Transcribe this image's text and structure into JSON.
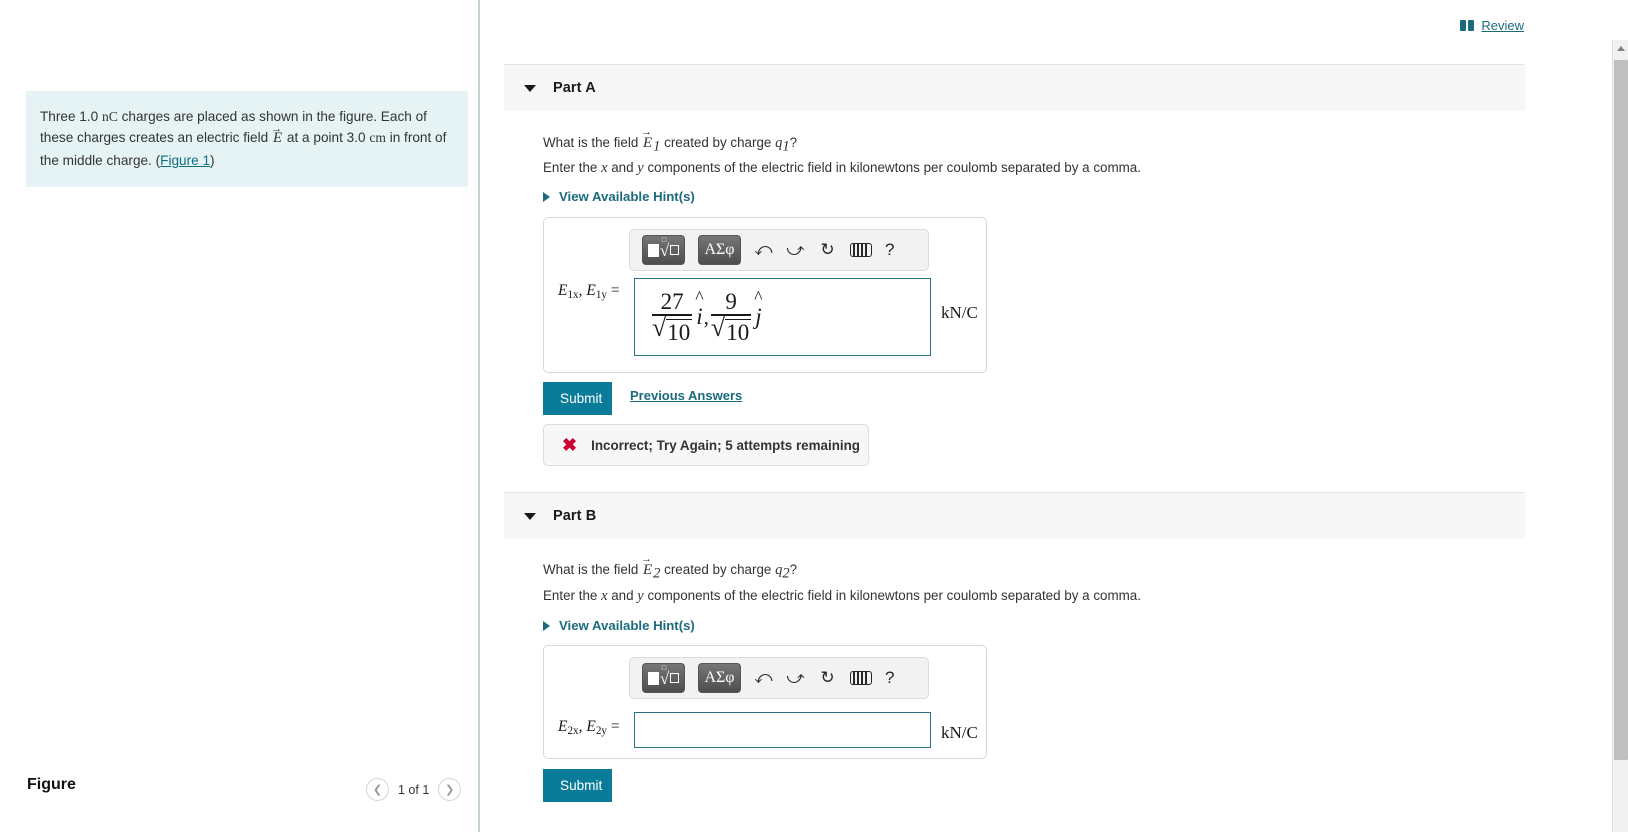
{
  "header": {
    "review_label": "Review",
    "book_icon": "book-icon"
  },
  "left_pane": {
    "problem": {
      "line1_a": "Three 1.0 ",
      "line1_unit": "nC",
      "line1_b": " charges are placed as shown in the figure. Each of these charges creates an electric field ",
      "field_symbol": "E",
      "line2_a": " at a point 3.0 ",
      "line2_unit": "cm",
      "line2_b": " in front of the middle charge. (",
      "figure_link": "Figure 1",
      "line2_c": ")"
    },
    "figure_title": "Figure",
    "figure_counter": "1 of 1",
    "prev_icon": "chevron-left-icon",
    "next_icon": "chevron-right-icon"
  },
  "math_toolbar": {
    "sqrt_button": "sqrt-template-button",
    "greek_button": "ΑΣφ",
    "undo_icon": "undo-icon",
    "redo_icon": "redo-icon",
    "reset_icon": "reset-icon",
    "keyboard_icon": "keyboard-icon",
    "help_icon": "?"
  },
  "parts": [
    {
      "id": "part-a",
      "title": "Part A",
      "caret": "caret-down-icon",
      "question_prefix": "What is the field ",
      "question_field": "E",
      "question_field_sub": "1",
      "question_mid": " created by charge ",
      "question_charge": "q",
      "question_charge_sub": "1",
      "question_suffix": "?",
      "instruction_a": "Enter the ",
      "instruction_x": "x",
      "instruction_b": " and ",
      "instruction_y": "y",
      "instruction_c": " components of the electric field in kilonewtons per coulomb separated by a comma.",
      "hint_label": "View Available Hint(s)",
      "answer_label_main": "E",
      "answer_label_sub1": "1x",
      "answer_label_sub2": "1y",
      "answer_label_eq": "=",
      "units": "kN/C",
      "answer_value": {
        "term1": {
          "numerator": "27",
          "denominator_root": "10",
          "unit_vector": "i",
          "hat": "^"
        },
        "separator": ",",
        "term2": {
          "numerator": "9",
          "denominator_root": "10",
          "unit_vector": "j",
          "hat": "^"
        }
      },
      "answer_value_text": "27/sqrt(10) i, 9/sqrt(10) j",
      "submit_label": "Submit",
      "previous_answers_label": "Previous Answers",
      "status": {
        "icon": "x-mark-icon",
        "text": "Incorrect; Try Again; 5 attempts remaining",
        "color": "#cc0033"
      }
    },
    {
      "id": "part-b",
      "title": "Part B",
      "caret": "caret-down-icon",
      "question_prefix": "What is the field ",
      "question_field": "E",
      "question_field_sub": "2",
      "question_mid": " created by charge ",
      "question_charge": "q",
      "question_charge_sub": "2",
      "question_suffix": "?",
      "instruction_a": "Enter the ",
      "instruction_x": "x",
      "instruction_b": " and ",
      "instruction_y": "y",
      "instruction_c": " components of the electric field in kilonewtons per coulomb separated by a comma.",
      "hint_label": "View Available Hint(s)",
      "answer_label_main": "E",
      "answer_label_sub1": "2x",
      "answer_label_sub2": "2y",
      "answer_label_eq": "=",
      "units": "kN/C",
      "answer_value_text": "",
      "submit_label": "Submit"
    }
  ],
  "colors": {
    "accent_teal": "#0a7c99",
    "link_teal": "#1b6b7d",
    "problem_bg": "#e6f3f4",
    "band_bg": "#f7f7f7",
    "error_red": "#cc0033",
    "input_border": "#2a7185"
  },
  "scrollbar": {
    "up_icon": "scroll-up-arrow-icon",
    "thumb": "scrollbar-thumb"
  }
}
